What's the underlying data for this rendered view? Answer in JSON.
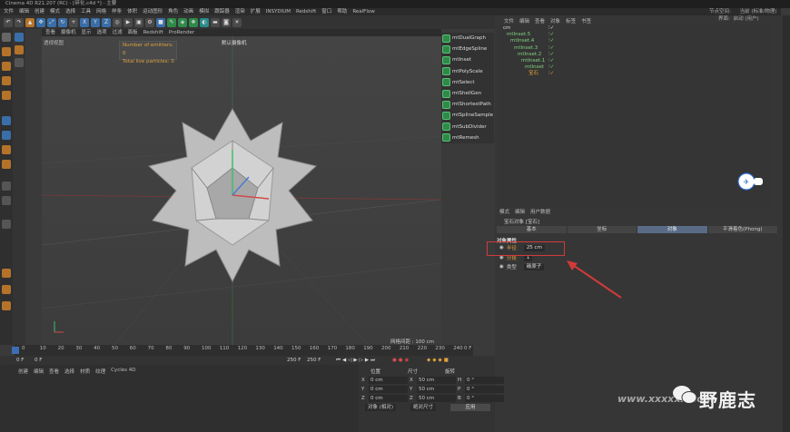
{
  "window": {
    "title": "Cinema 4D R21.207 (RC) - [碎化.c4d *] - 主要"
  },
  "menubar": [
    "文件",
    "编辑",
    "创建",
    "模式",
    "选择",
    "工具",
    "网格",
    "样条",
    "体积",
    "运动图形",
    "角色",
    "动画",
    "模拟",
    "跟踪器",
    "渲染",
    "扩展",
    "INSYDIUM",
    "Redshift",
    "窗口",
    "帮助",
    "RealFlow"
  ],
  "toolbar_icons": [
    "undo-icon",
    "redo-icon",
    "select-icon",
    "move-icon",
    "scale-icon",
    "rotate-icon",
    "plus-icon",
    "x-axis-icon",
    "y-axis-icon",
    "z-axis-icon",
    "world-icon",
    "render-icon",
    "render-view-icon",
    "render-settings-icon",
    "cube-icon",
    "pen-icon",
    "subdivision-icon",
    "cloner-icon",
    "deformer-icon",
    "floor-icon",
    "camera-icon",
    "light-icon"
  ],
  "viewport": {
    "menu": [
      "查看",
      "摄像机",
      "显示",
      "选项",
      "过滤",
      "面板",
      "Redshift",
      "ProRender"
    ],
    "perspective": "透视视图",
    "camera": "默认摄像机",
    "info": [
      "Number of emitters: 0",
      "Total live particles: 0"
    ],
    "grid_info": "网格间距 : 100 cm"
  },
  "mt_panel": {
    "items": [
      "mtDualGraph",
      "mtEdgeSpline",
      "mtInset",
      "mtPolyScale",
      "mtSelect",
      "mtShellGen",
      "mtShortestPath",
      "mtSplineSample",
      "mtSubDivider",
      "mtRemesh"
    ]
  },
  "objects": {
    "header": "节点空间:",
    "layout_value": "当前 (标准/物理)",
    "layout_label": "界面:",
    "layout_mode": "启动 (用户)",
    "menu": [
      "文件",
      "编辑",
      "查看",
      "对象",
      "标签",
      "书签"
    ],
    "rows": [
      {
        "name": "cm",
        "depth": 0
      },
      {
        "name": "mtInset.5",
        "depth": 1
      },
      {
        "name": "mtInset.4",
        "depth": 2
      },
      {
        "name": "mtInset.3",
        "depth": 3
      },
      {
        "name": "mtInset.2",
        "depth": 4
      },
      {
        "name": "mtInset.1",
        "depth": 5
      },
      {
        "name": "mtInset",
        "depth": 6
      },
      {
        "name": "宝石",
        "depth": 7
      }
    ]
  },
  "attributes": {
    "menu": [
      "模式",
      "编辑",
      "用户数据"
    ],
    "title": "宝石对象 [宝石]",
    "tabs": [
      "基本",
      "坐标",
      "对象",
      "平滑着色(Phong)"
    ],
    "section": "对象属性",
    "fields": [
      {
        "label": "半径",
        "value": "25 cm"
      },
      {
        "label": "分段",
        "value": "1"
      },
      {
        "label": "类型",
        "value": "碳原子"
      }
    ]
  },
  "timeline": {
    "ticks": [
      "0",
      "10",
      "20",
      "30",
      "40",
      "50",
      "60",
      "70",
      "80",
      "90",
      "100",
      "110",
      "120",
      "130",
      "140",
      "150",
      "160",
      "170",
      "180",
      "190",
      "200",
      "210",
      "220",
      "230",
      "240"
    ],
    "end_label": "25",
    "current": "0 F"
  },
  "transport": {
    "start": "0 F",
    "current": "0 F",
    "end": "250 F",
    "end2": "250 F"
  },
  "materials": {
    "menu": [
      "创建",
      "编辑",
      "查看",
      "选择",
      "材质",
      "纹理",
      "Cycles 4D"
    ]
  },
  "coords": {
    "headers": [
      "位置",
      "尺寸",
      "旋转"
    ],
    "rows": [
      {
        "axis": "X",
        "pos": "0 cm",
        "size": "50 cm",
        "rot_axis": "H",
        "rot": "0 °"
      },
      {
        "axis": "Y",
        "pos": "0 cm",
        "size": "50 cm",
        "rot_axis": "P",
        "rot": "0 °"
      },
      {
        "axis": "Z",
        "pos": "0 cm",
        "size": "50 cm",
        "rot_axis": "B",
        "rot": "0 °"
      }
    ],
    "mode1": "对象 (相对)",
    "mode2": "绝对尺寸",
    "apply": "应用"
  },
  "watermark": {
    "text": "野鹿志",
    "sub": "www.xxxxxx.com"
  },
  "colors": {
    "accent_orange": "#e0a23c",
    "highlight_red": "#d23a3a",
    "tab_active": "#5a6b86",
    "mt_green": "#2f8a4a"
  }
}
